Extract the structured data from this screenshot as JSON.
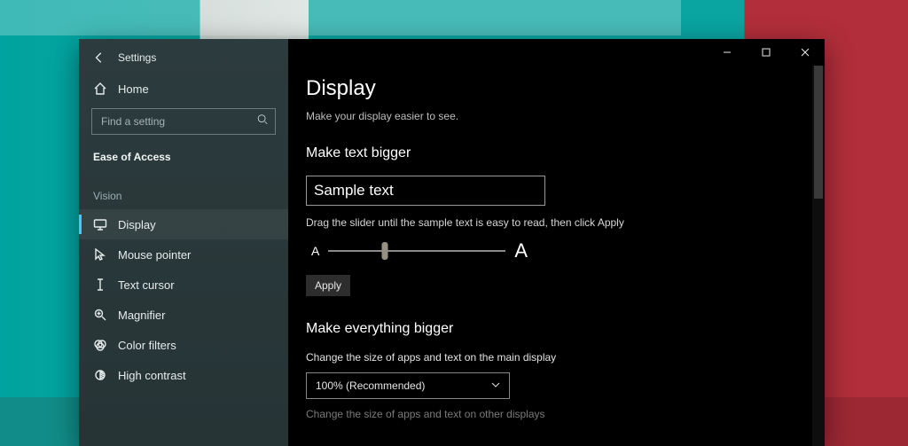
{
  "app": {
    "title": "Settings"
  },
  "sidebar": {
    "home_label": "Home",
    "search_placeholder": "Find a setting",
    "breadcrumb": "Ease of Access",
    "group_label": "Vision",
    "items": [
      {
        "label": "Display",
        "selected": true
      },
      {
        "label": "Mouse pointer",
        "selected": false
      },
      {
        "label": "Text cursor",
        "selected": false
      },
      {
        "label": "Magnifier",
        "selected": false
      },
      {
        "label": "Color filters",
        "selected": false
      },
      {
        "label": "High contrast",
        "selected": false
      }
    ]
  },
  "page": {
    "title": "Display",
    "subtitle": "Make your display easier to see.",
    "make_text_bigger": {
      "heading": "Make text bigger",
      "sample_text": "Sample text",
      "slider_hint": "Drag the slider until the sample text is easy to read, then click Apply",
      "small_a": "A",
      "big_a": "A",
      "apply_label": "Apply"
    },
    "make_everything_bigger": {
      "heading": "Make everything bigger",
      "label": "Change the size of apps and text on the main display",
      "selected_value": "100% (Recommended)",
      "other_displays_label": "Change the size of apps and text on other displays"
    }
  }
}
